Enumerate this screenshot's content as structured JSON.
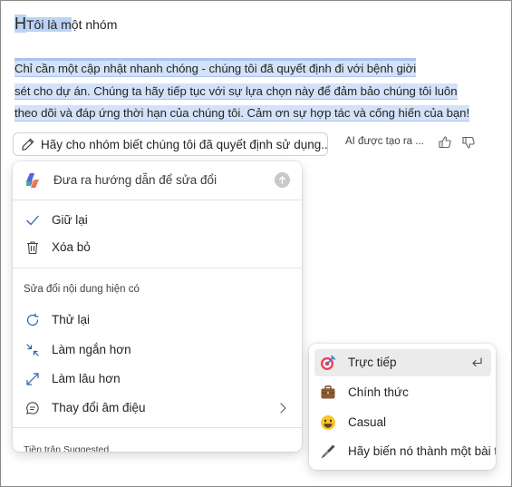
{
  "document": {
    "greeting_cursor": "H",
    "greeting_selected": "Tôi là m",
    "greeting_rest": "ột nhóm",
    "paragraph_lines": [
      "Chỉ cần một cập nhật nhanh chóng - chúng tôi đã quyết định đi với bệnh giời",
      "sét cho dự án. Chúng ta hãy tiếp tục với sự lựa chọn này để đảm bảo chúng tôi luôn",
      "theo dõi và đáp ứng thời hạn của chúng tôi. Cảm ơn sự hợp tác và cống hiến của bạn!"
    ]
  },
  "suggestion": {
    "text": "Hãy cho nhóm biết chúng tôi đã quyết định sử dụng...",
    "ai_note": "AI được tạo ra ..."
  },
  "menu": {
    "prompt_placeholder": "Đưa ra hướng dẫn để sửa đổi",
    "keep_label": "Giữ lại",
    "delete_label": "Xóa bỏ",
    "section_title": "Sửa đổi nội dung hiện có",
    "retry_label": "Thử lại",
    "shorter_label": "Làm ngắn hơn",
    "longer_label": "Làm lâu hơn",
    "tone_label": "Thay đổi âm điệu",
    "footer_title": "Tiền trận Suggested"
  },
  "tone_submenu": {
    "items": [
      "Trực tiếp",
      "Chính thức",
      "Casual",
      "Hãy biến nó thành một bài thơ"
    ]
  },
  "colors": {
    "selection": "#bcd3f5",
    "highlight": "#d3e2f8",
    "accent_blue": "#2f5fb3"
  }
}
